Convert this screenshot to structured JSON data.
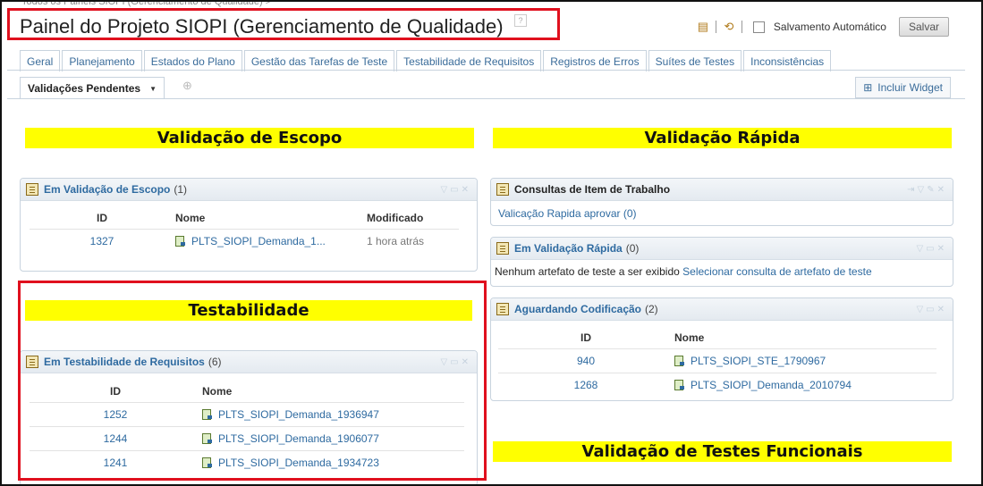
{
  "breadcrumb": "Todos os Painéis SIOPI (Gerenciamento de Qualidade) >",
  "page_title": "Painel do Projeto SIOPI (Gerenciamento de Qualidade)",
  "help_icon": "?",
  "toolbar": {
    "autosave_label": "Salvamento Automático",
    "save_label": "Salvar"
  },
  "tabs": [
    {
      "label": "Geral"
    },
    {
      "label": "Planejamento"
    },
    {
      "label": "Estados do Plano"
    },
    {
      "label": "Gestão das Tarefas de Teste"
    },
    {
      "label": "Testabilidade de Requisitos"
    },
    {
      "label": "Registros de Erros"
    },
    {
      "label": "Suítes de Testes"
    },
    {
      "label": "Inconsistências"
    }
  ],
  "subtab": {
    "label": "Validações Pendentes",
    "add": "⊕"
  },
  "include_widget": "Incluir Widget",
  "banners": {
    "escopo": "Validação de Escopo",
    "rapida": "Validação Rápida",
    "testabilidade": "Testabilidade",
    "funcionais": "Validação de Testes Funcionais"
  },
  "widgets": {
    "escopo": {
      "title": "Em Validação de Escopo",
      "count": "(1)",
      "headers": {
        "id": "ID",
        "name": "Nome",
        "modified": "Modificado"
      },
      "rows": [
        {
          "id": "1327",
          "name": "PLTS_SIOPI_Demanda_1...",
          "modified": "1 hora atrás"
        }
      ]
    },
    "consultas": {
      "title": "Consultas de Item de Trabalho",
      "link": "Valicação Rapida aprovar (0)"
    },
    "rapida": {
      "title": "Em Validação Rápida",
      "count": "(0)",
      "empty_text": "Nenhum artefato de teste a ser exibido",
      "select_link": "Selecionar consulta de artefato de teste"
    },
    "codificacao": {
      "title": "Aguardando Codificação",
      "count": "(2)",
      "headers": {
        "id": "ID",
        "name": "Nome"
      },
      "rows": [
        {
          "id": "940",
          "name": "PLTS_SIOPI_STE_1790967"
        },
        {
          "id": "1268",
          "name": "PLTS_SIOPI_Demanda_2010794"
        }
      ]
    },
    "testabilidade": {
      "title": "Em Testabilidade de Requisitos",
      "count": "(6)",
      "headers": {
        "id": "ID",
        "name": "Nome"
      },
      "rows": [
        {
          "id": "1252",
          "name": "PLTS_SIOPI_Demanda_1936947"
        },
        {
          "id": "1244",
          "name": "PLTS_SIOPI_Demanda_1906077"
        },
        {
          "id": "1241",
          "name": "PLTS_SIOPI_Demanda_1934723"
        }
      ]
    }
  }
}
